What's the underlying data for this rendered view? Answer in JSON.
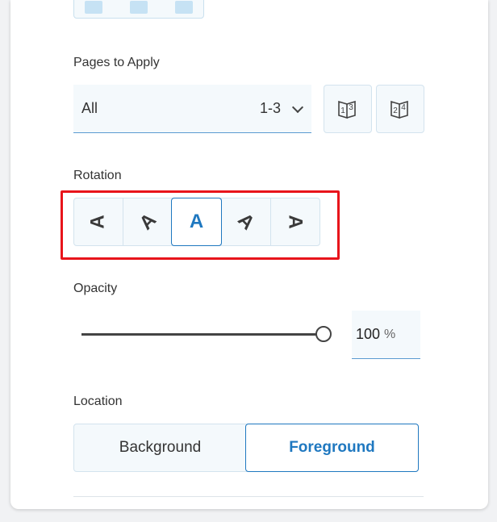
{
  "pages_to_apply": {
    "label": "Pages to Apply",
    "selected_value": "All",
    "range": "1-3",
    "buttons": [
      {
        "name": "odd-pages-icon",
        "glyphs": [
          "1",
          "3"
        ]
      },
      {
        "name": "even-pages-icon",
        "glyphs": [
          "2",
          "4"
        ]
      }
    ]
  },
  "rotation": {
    "label": "Rotation",
    "glyph": "A",
    "options": [
      {
        "glyph": "A"
      },
      {
        "glyph": "A"
      },
      {
        "glyph": "A",
        "active": true
      },
      {
        "glyph": "A"
      },
      {
        "glyph": "A"
      }
    ]
  },
  "opacity": {
    "label": "Opacity",
    "value": "100",
    "unit": "%",
    "slider_fraction": 1.0
  },
  "location": {
    "label": "Location",
    "options": [
      {
        "label": "Background",
        "active": false
      },
      {
        "label": "Foreground",
        "active": true
      }
    ]
  },
  "colors": {
    "accent": "#1f78c0",
    "highlight_box": "#e8141b",
    "control_bg": "#f4f9fc"
  }
}
